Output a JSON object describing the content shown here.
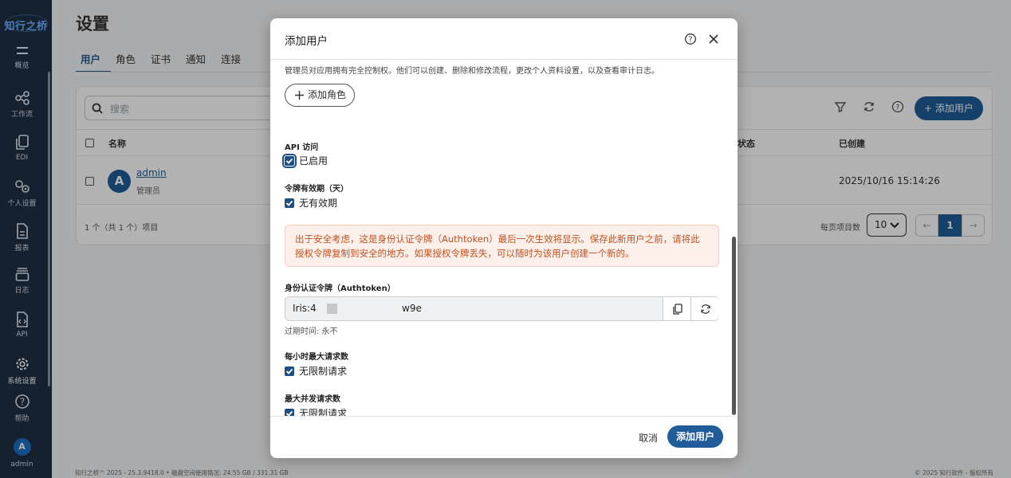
{
  "app": {
    "logo_text": "知行之桥"
  },
  "sidebar": {
    "items": [
      {
        "label": "概览",
        "icon": "overview-icon"
      },
      {
        "label": "工作流",
        "icon": "workflow-icon"
      },
      {
        "label": "EDI",
        "icon": "edi-icon"
      },
      {
        "label": "个人设置",
        "icon": "personal-settings-icon"
      },
      {
        "label": "报表",
        "icon": "report-icon"
      },
      {
        "label": "日志",
        "icon": "log-icon"
      },
      {
        "label": "API",
        "icon": "api-icon"
      },
      {
        "label": "系统设置",
        "icon": "gear-icon"
      },
      {
        "label": "帮助",
        "icon": "help-icon"
      }
    ],
    "user": {
      "initial": "A",
      "name": "admin"
    }
  },
  "page": {
    "title": "设置",
    "tabs": [
      "用户",
      "角色",
      "证书",
      "通知",
      "连接"
    ],
    "active_tab": "用户"
  },
  "users_table": {
    "search_placeholder": "搜索",
    "add_button": "添加用户",
    "columns": {
      "name": "名称",
      "status": "状态",
      "created": "已创建"
    },
    "rows": [
      {
        "initial": "A",
        "name": "admin",
        "role": "管理员",
        "created": "2025/10/16 15:14:26"
      }
    ],
    "pager_text": "1 个（共 1 个）项目",
    "per_page_label": "每页项目数",
    "per_page": "10",
    "current_page": "1"
  },
  "footer": {
    "left": "知行之桥™ 2025 - 25.3.9418.0  •  磁盘空间使用情况:  24.55 GB / 331.31 GB",
    "right": "© 2025 知行软件 - 版权所有"
  },
  "modal": {
    "title": "添加用户",
    "description": "管理员对应用拥有完全控制权。他们可以创建、删除和修改流程，更改个人资料设置，以及查看审计日志。",
    "add_role_label": "添加角色",
    "api_access": {
      "label": "API 访问",
      "option": "已启用",
      "checked": true
    },
    "token_expiry": {
      "label": "令牌有效期（天）",
      "option": "无有效期",
      "checked": true
    },
    "warning": "出于安全考虑，这是身份认证令牌（Authtoken）最后一次生效将显示。保存此新用户之前，请将此授权令牌复制到安全的地方。如果授权令牌丢失，可以随时为该用户创建一个新的。",
    "authtoken": {
      "label": "身份认证令牌（Authtoken）",
      "value_start": "Iris:4",
      "value_end": "w9e",
      "expire_text": "过期时间:  永不"
    },
    "max_requests_hour": {
      "label": "每小时最大请求数",
      "option": "无限制请求",
      "checked": true
    },
    "max_concurrent": {
      "label": "最大并发请求数",
      "option": "无限制请求",
      "checked": true
    },
    "cancel_label": "取消",
    "submit_label": "添加用户"
  }
}
